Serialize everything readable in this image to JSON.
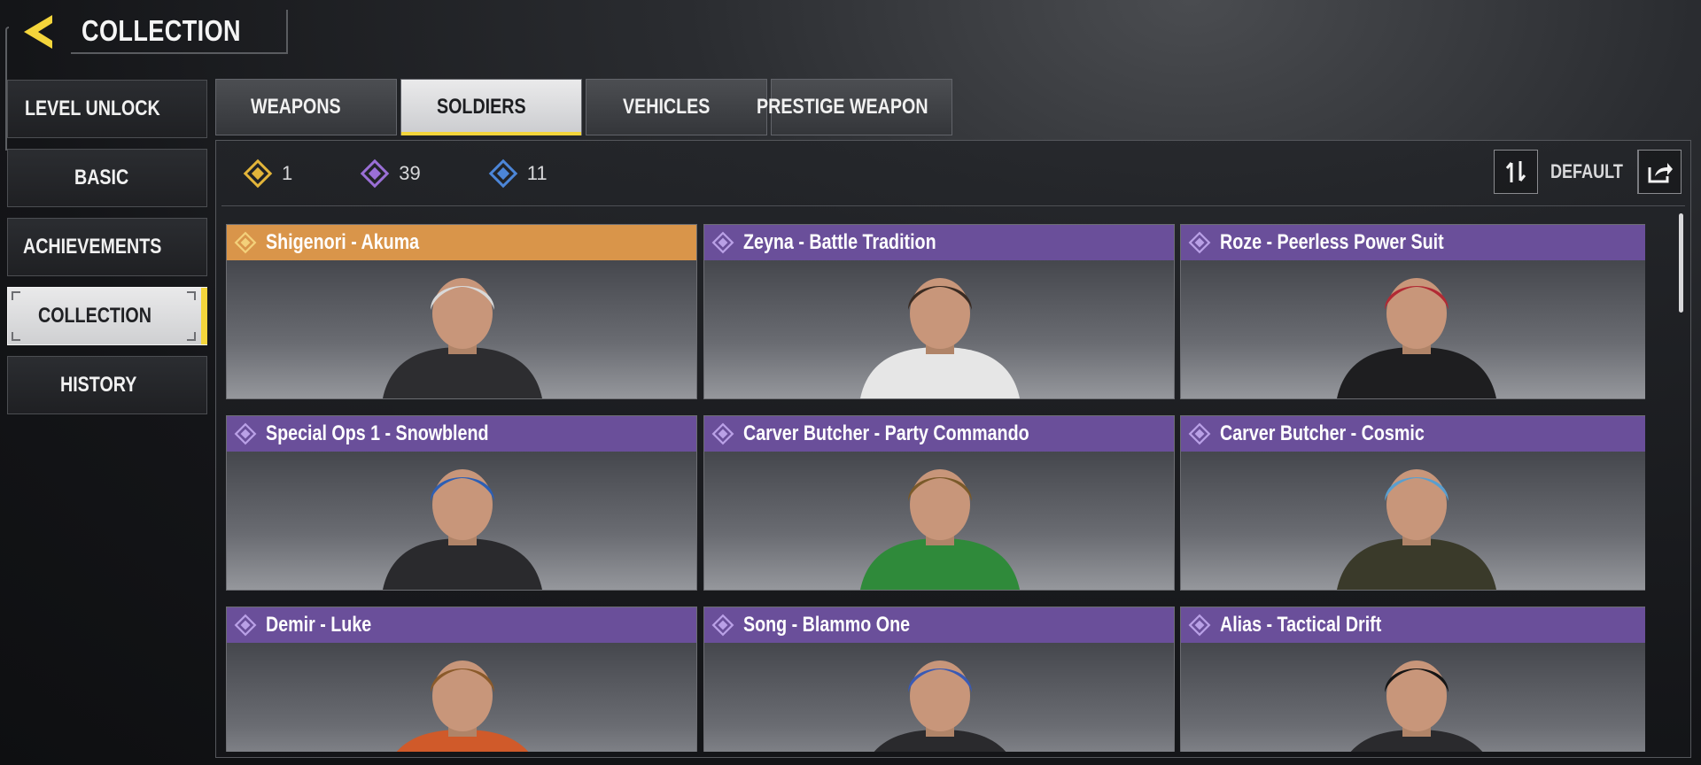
{
  "header": {
    "title": "COLLECTION",
    "back_icon": "back-arrow-icon",
    "accent_color": "#f4d53b"
  },
  "sidebar": {
    "items": [
      {
        "label": "LEVEL UNLOCK",
        "active": false
      },
      {
        "label": "BASIC",
        "active": false
      },
      {
        "label": "ACHIEVEMENTS",
        "active": false
      },
      {
        "label": "COLLECTION",
        "active": true
      },
      {
        "label": "HISTORY",
        "active": false
      }
    ]
  },
  "tabs": [
    {
      "label": "WEAPONS",
      "active": false
    },
    {
      "label": "SOLDIERS",
      "active": true
    },
    {
      "label": "VEHICLES",
      "active": false
    },
    {
      "label": "PRESTIGE WEAPON",
      "active": false
    }
  ],
  "counters": [
    {
      "rarity": "legendary",
      "value": "1",
      "color": "#e3b53a",
      "icon": "legendary-diamond-icon"
    },
    {
      "rarity": "epic",
      "value": "39",
      "color": "#9a6fd6",
      "icon": "epic-diamond-icon"
    },
    {
      "rarity": "rare",
      "value": "11",
      "color": "#4c86d8",
      "icon": "rare-diamond-icon"
    }
  ],
  "sort": {
    "label": "DEFAULT",
    "sort_icon": "sort-arrows-icon",
    "share_icon": "share-icon"
  },
  "cards": [
    {
      "name": "Shigenori - Akuma",
      "rarity": "legendary",
      "header_color": "#d9954a",
      "hair": "#d9d9d9",
      "outfit": "#2d2d30"
    },
    {
      "name": "Zeyna - Battle Tradition",
      "rarity": "epic",
      "header_color": "#6a4f9a",
      "hair": "#3a2b22",
      "outfit": "#e6e6e6"
    },
    {
      "name": "Roze - Peerless Power Suit",
      "rarity": "epic",
      "header_color": "#6a4f9a",
      "hair": "#b22a34",
      "outfit": "#1e1e20"
    },
    {
      "name": "Special Ops 1 - Snowblend",
      "rarity": "epic",
      "header_color": "#6a4f9a",
      "hair": "#2d5fb5",
      "outfit": "#2a2a2d"
    },
    {
      "name": "Carver Butcher - Party Commando",
      "rarity": "epic",
      "header_color": "#6a4f9a",
      "hair": "#7a5a2a",
      "outfit": "#2f8a3a"
    },
    {
      "name": "Carver Butcher - Cosmic",
      "rarity": "epic",
      "header_color": "#6a4f9a",
      "hair": "#5a9fcf",
      "outfit": "#3a3a2a"
    },
    {
      "name": "Demir - Luke",
      "rarity": "epic",
      "header_color": "#6a4f9a",
      "hair": "#8a5a2a",
      "outfit": "#d05a2a"
    },
    {
      "name": "Song - Blammo One",
      "rarity": "epic",
      "header_color": "#6a4f9a",
      "hair": "#3a5ab5",
      "outfit": "#2a2a2d"
    },
    {
      "name": "Alias - Tactical Drift",
      "rarity": "epic",
      "header_color": "#6a4f9a",
      "hair": "#151515",
      "outfit": "#2a2a2d"
    }
  ]
}
